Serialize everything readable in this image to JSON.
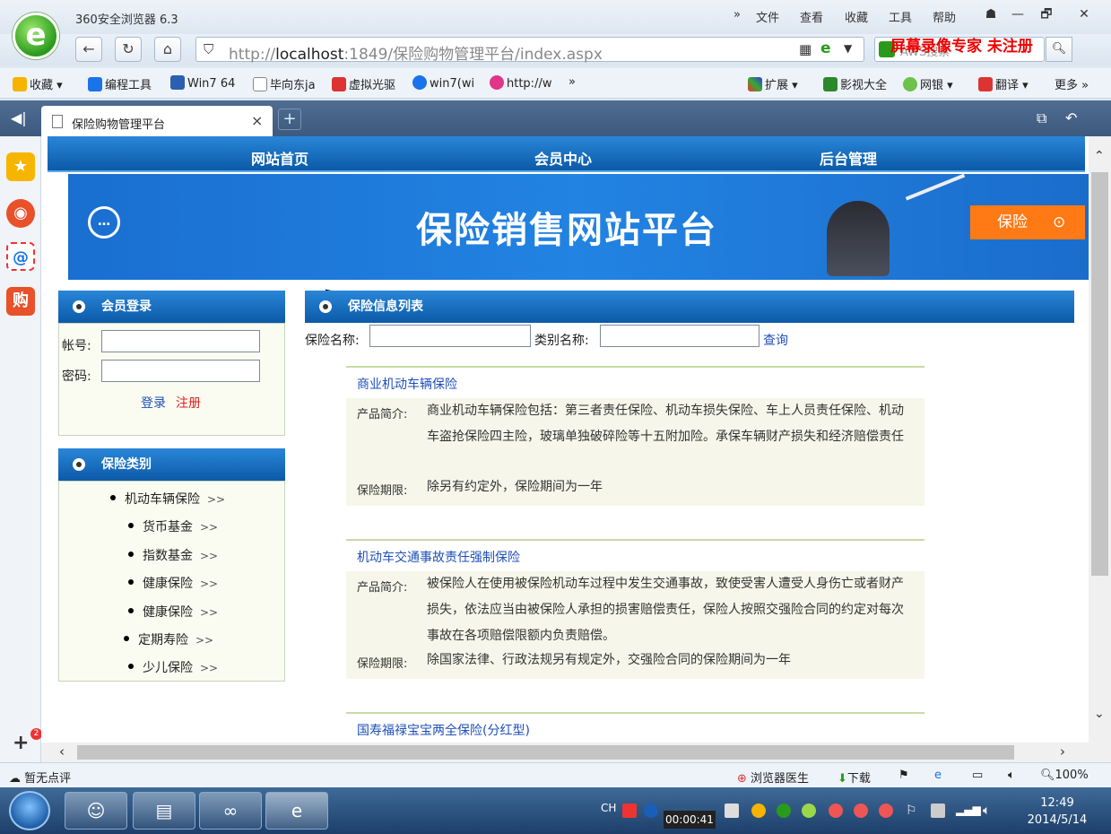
{
  "window": {
    "app_title": "360安全浏览器 6.3",
    "menu": [
      "»",
      "文件",
      "查看",
      "收藏",
      "工具",
      "帮助"
    ],
    "controls": [
      "—",
      "🗗",
      "✕"
    ]
  },
  "addressbar": {
    "url_prefix": "http://",
    "url_host": "localhost",
    "url_rest": ":1849/保险购物管理平台/index.aspx",
    "search_placeholder": "AWS搜索"
  },
  "watermark": "屏幕录像专家 未注册",
  "bookmarks": {
    "left": [
      "收藏",
      "编程工具",
      "Win7 64",
      "毕向东ja",
      "虚拟光驱",
      "win7(wi",
      "http://w",
      "»"
    ],
    "right": [
      "扩展",
      "影视大全",
      "网银",
      "翻译",
      "更多 »"
    ]
  },
  "tab": {
    "label": "保险购物管理平台",
    "close": "×",
    "new": "+"
  },
  "site": {
    "nav": [
      "网站首页",
      "会员中心",
      "后台管理"
    ],
    "banner_title": "保险销售网站平台",
    "banner_tag": "保险",
    "login": {
      "header": "会员登录",
      "account_label": "帐号:",
      "password_label": "密码:",
      "login_link": "登录",
      "register_link": "注册"
    },
    "categories": {
      "header": "保险类别",
      "items": [
        "机动车辆保险",
        "货币基金",
        "指数基金",
        "健康保险",
        "健康保险",
        "定期寿险",
        "少儿保险"
      ],
      "arrow": ">>"
    },
    "list": {
      "header": "保险信息列表",
      "name_label": "保险名称:",
      "category_label": "类别名称:",
      "query_link": "查询",
      "intro_label": "产品简介:",
      "period_label": "保险期限:",
      "items": [
        {
          "title": "商业机动车辆保险",
          "intro": "商业机动车辆保险包括：第三者责任保险、机动车损失保险、车上人员责任保险、机动车盗抢保险四主险，玻璃单独破碎险等十五附加险。承保车辆财产损失和经济赔偿责任",
          "period": "除另有约定外，保险期间为一年"
        },
        {
          "title": "机动车交通事故责任强制保险",
          "intro": "被保险人在使用被保险机动车过程中发生交通事故，致使受害人遭受人身伤亡或者财产损失，依法应当由被保险人承担的损害赔偿责任，保险人按照交强险合同的约定对每次事故在各项赔偿限额内负责赔偿。",
          "period": "除国家法律、行政法规另有规定外，交强险合同的保险期间为一年"
        },
        {
          "title": "国寿福禄宝宝两全保险(分红型)"
        }
      ]
    }
  },
  "statusbar": {
    "left": "暂无点评",
    "items": [
      "浏览器医生",
      "下载",
      "100%"
    ]
  },
  "taskbar": {
    "lang": "CH",
    "rec_time": "00:00:41",
    "time": "12:49",
    "date": "2014/5/14"
  },
  "colors": {
    "nav_blue": "#0b5aa8",
    "banner_blue": "#2283e2",
    "tag_orange": "#ff7a14",
    "link_blue": "#1f4fb8",
    "link_red": "#e02020"
  }
}
